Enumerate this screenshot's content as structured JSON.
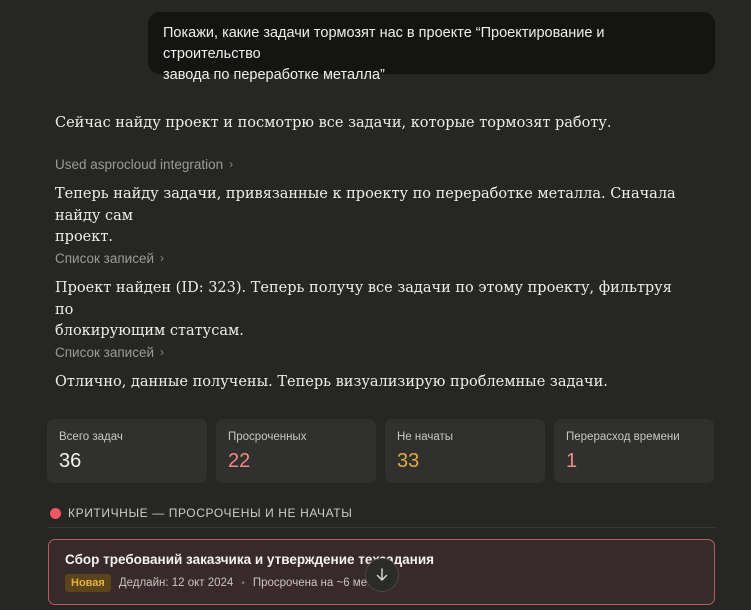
{
  "user_message": {
    "line1": "Покажи, какие задачи тормозят нас в проекте “Проектирование и строительство",
    "line2": "завода по переработке металла”"
  },
  "assistant": {
    "msg1": "Сейчас найду проект и посмотрю все задачи, которые тормозят работу.",
    "tool1": "Used asprocloud integration",
    "msg2_line1": "Теперь найду задачи, привязанные к проекту по переработке металла. Сначала найду сам",
    "msg2_line2": "проект.",
    "tool2": "Список записей",
    "msg3_line1": "Проект найден (ID: 323). Теперь получу все задачи по этому проекту, фильтруя по",
    "msg3_line2": "блокирующим статусам.",
    "tool3": "Список записей",
    "msg4": "Отлично, данные получены. Теперь визуализирую проблемные задачи."
  },
  "stats": [
    {
      "label": "Всего задач",
      "value": "36",
      "color": "#f2f0ea"
    },
    {
      "label": "Просроченных",
      "value": "22",
      "color": "#f08a80"
    },
    {
      "label": "Не начаты",
      "value": "33",
      "color": "#e3a93f"
    },
    {
      "label": "Перерасход времени",
      "value": "1",
      "color": "#f08a80"
    }
  ],
  "section": {
    "title": "КРИТИЧНЫЕ — ПРОСРОЧЕНЫ И НЕ НАЧАТЫ",
    "accent": "#f05665"
  },
  "task": {
    "title": "Сбор требований заказчика и утверждение техзадания",
    "badge": "Новая",
    "deadline": "Дедлайн: 12 окт 2024",
    "overdue": "Просрочена на ~6 мес"
  },
  "icons": {
    "tool_chevron": "chevron-right-icon",
    "scroll": "arrow-down-icon",
    "section": "red-dot-icon"
  }
}
